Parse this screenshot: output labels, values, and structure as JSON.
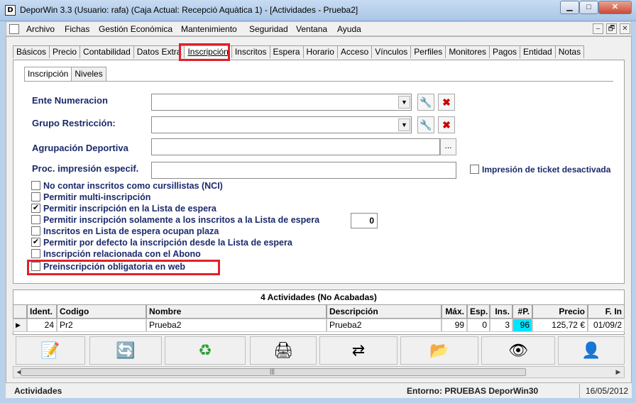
{
  "window": {
    "app_icon": "D",
    "title": "DeporWin 3.3  (Usuario: rafa)  (Caja Actual: Recepció Aquàtica 1) - [Actividades - Prueba2]",
    "minimize": "▁",
    "maximize": "□",
    "close": "✕"
  },
  "menu": {
    "items": [
      "Archivo",
      "Fichas",
      "Gestión Económica",
      "Mantenimiento",
      "Seguridad",
      "Ventana",
      "Ayuda"
    ],
    "mdi_buttons": [
      "‒",
      "🗗",
      "✕"
    ]
  },
  "tabs": [
    "Básicos",
    "Precio",
    "Contabilidad",
    "Datos Extra",
    "Inscripción",
    "Inscritos",
    "Espera",
    "Horario",
    "Acceso",
    "Vínculos",
    "Perfiles",
    "Monitores",
    "Pagos",
    "Entidad",
    "Notas"
  ],
  "active_tab": "Inscripción",
  "subtabs": [
    "Inscripción",
    "Niveles"
  ],
  "form": {
    "ente_numeracion_label": "Ente Numeracion",
    "grupo_restriccion_label": "Grupo Restricción:",
    "agrupacion_label": "Agrupación Deportiva",
    "proc_impresion_label": "Proc. impresión especif.",
    "ente_numeracion_value": "",
    "grupo_restriccion_value": "",
    "agrupacion_value": "",
    "proc_impresion_value": "",
    "ellipsis": "...",
    "ticket_label": "Impresión de ticket desactivada",
    "espera_num": "0"
  },
  "checkboxes": [
    {
      "label": "No contar inscritos como cursillistas (NCI)",
      "checked": false
    },
    {
      "label": "Permitir multi-inscripción",
      "checked": false
    },
    {
      "label": "Permitir inscripción en la Lista de espera",
      "checked": true
    },
    {
      "label": "Permitir inscripción solamente a los inscritos a la Lista de espera",
      "checked": false
    },
    {
      "label": "Inscritos en Lista de espera ocupan plaza",
      "checked": false
    },
    {
      "label": "Permitir por defecto la inscripción desde la Lista de espera",
      "checked": true
    },
    {
      "label": "Inscripción relacionada con el Abono",
      "checked": false
    },
    {
      "label": "Preinscripción obligatoria en web",
      "checked": false
    }
  ],
  "grid": {
    "title": "4 Actividades  (No Acabadas)",
    "columns": [
      "Ident.",
      "Codigo",
      "Nombre",
      "Descripción",
      "Máx.",
      "Esp.",
      "Ins.",
      "#P.",
      "Precio",
      "F. In"
    ],
    "row": [
      "24",
      "Pr2",
      "Prueba2",
      "Prueba2",
      "99",
      "0",
      "3",
      "96",
      "125,72 €",
      "01/09/2"
    ],
    "row_indicator": "▶"
  },
  "toolbar": [
    "edit-icon",
    "refresh-icon",
    "recycle-icon",
    "printer-icon",
    "transfer-icon",
    "copy-icon",
    "eye-icon",
    "user-calendar-icon"
  ],
  "status": {
    "left": "Actividades",
    "entorno": "Entorno: PRUEBAS DeporWin30",
    "date": "16/05/2012"
  },
  "colors": {
    "label_blue": "#1b2a6b",
    "highlight_red": "#e0202a",
    "cell_cyan": "#00e5ff"
  }
}
